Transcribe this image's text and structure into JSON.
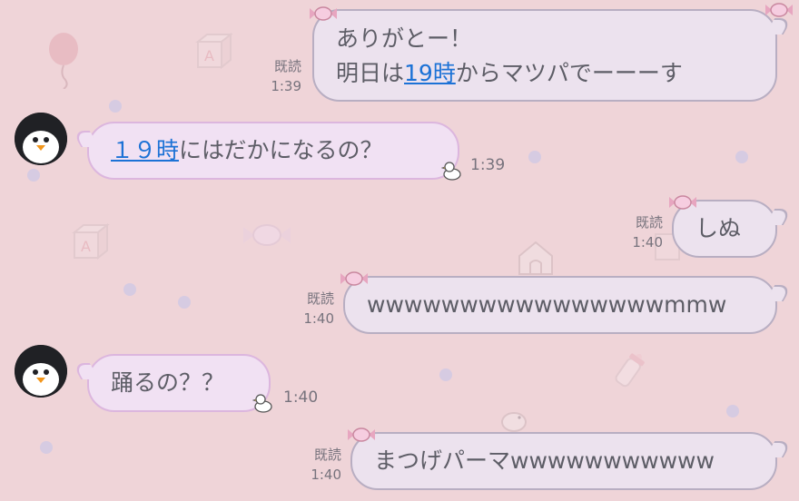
{
  "messages": [
    {
      "side": "out",
      "line1": "ありがとー！",
      "line2_pre": "明日は",
      "line2_link": "19時",
      "line2_post": "からマツパでーーーす",
      "read": "既読",
      "time": "1:39"
    },
    {
      "side": "in",
      "link": "１９時",
      "text": "にはだかになるの？",
      "time": "1:39"
    },
    {
      "side": "out",
      "text": "しぬ",
      "read": "既読",
      "time": "1:40"
    },
    {
      "side": "out",
      "text": "wwwwwwwwwwwwwwwwmmw",
      "read": "既読",
      "time": "1:40"
    },
    {
      "side": "in",
      "text": "踊るの？？",
      "time": "1:40"
    },
    {
      "side": "out",
      "text": "まつげパーマwwwwwwwwwww",
      "read": "既読",
      "time": "1:40"
    }
  ]
}
